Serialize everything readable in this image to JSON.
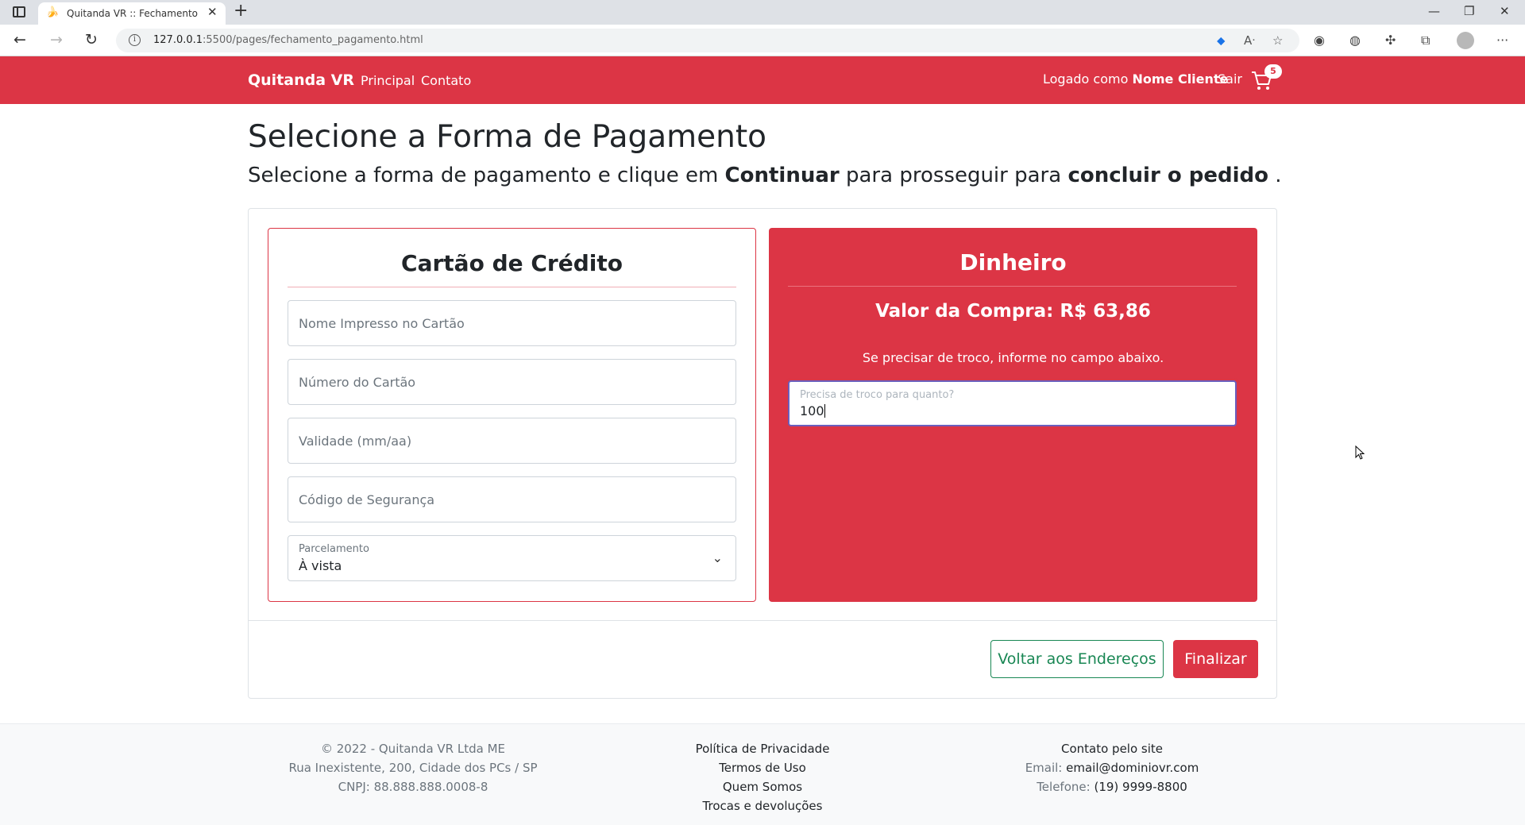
{
  "browser": {
    "tab_title": "Quitanda VR :: Fechamento de C",
    "url_host": "127.0.0.1",
    "url_path": ":5500/pages/fechamento_pagamento.html"
  },
  "navbar": {
    "brand": "Quitanda VR",
    "links": [
      "Principal",
      "Contato"
    ],
    "logged_prefix": "Logado como",
    "logged_user": "Nome Cliente",
    "logout": "Sair",
    "cart_count": "5"
  },
  "page": {
    "title": "Selecione a Forma de Pagamento",
    "subtitle_a": "Selecione a forma de pagamento e clique em",
    "subtitle_b": "Continuar",
    "subtitle_c": "para prosseguir para",
    "subtitle_d": "concluir o pedido",
    "subtitle_e": "."
  },
  "credit_card": {
    "title": "Cartão de Crédito",
    "fields": [
      {
        "placeholder": "Nome Impresso no Cartão"
      },
      {
        "placeholder": "Número do Cartão"
      },
      {
        "placeholder": "Validade (mm/aa)"
      },
      {
        "placeholder": "Código de Segurança"
      }
    ],
    "installments_label": "Parcelamento",
    "installments_value": "À vista"
  },
  "cash": {
    "title": "Dinheiro",
    "valor_label": "Valor da Compra:",
    "valor_amount": "R$ 63,86",
    "hint": "Se precisar de troco, informe no campo abaixo.",
    "troco_label": "Precisa de troco para quanto?",
    "troco_value": "100"
  },
  "actions": {
    "back": "Voltar aos Endereços",
    "finish": "Finalizar"
  },
  "footer": {
    "col1": [
      "© 2022 - Quitanda VR Ltda ME",
      "Rua Inexistente, 200, Cidade dos PCs / SP",
      "CNPJ: 88.888.888.0008-8"
    ],
    "col2": [
      "Política de Privacidade",
      "Termos de Uso",
      "Quem Somos",
      "Trocas e devoluções"
    ],
    "col3_title": "Contato pelo site",
    "email_label": "Email:",
    "email": "email@dominiovr.com",
    "phone_label": "Telefone:",
    "phone": "(19) 9999-8800"
  },
  "colors": {
    "brand_red": "#dc3545",
    "success_green": "#198754"
  }
}
